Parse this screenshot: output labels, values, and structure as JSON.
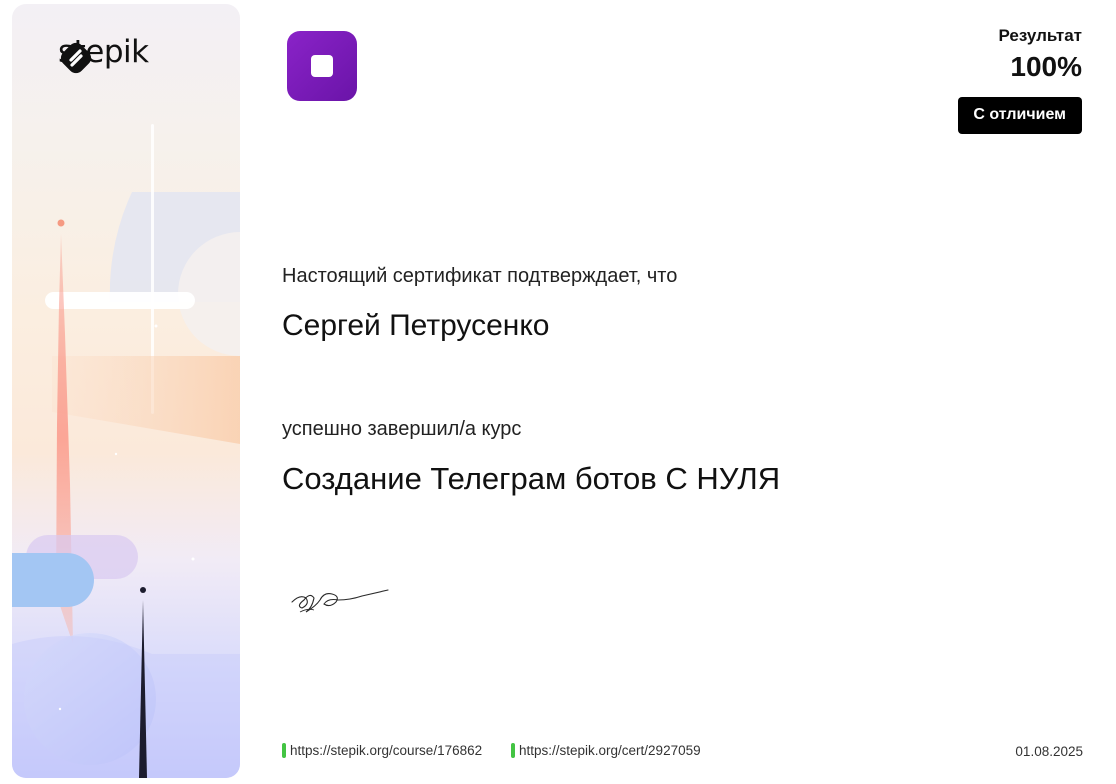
{
  "brand": {
    "name": "stepik"
  },
  "course_logo": {
    "color": "#7a1cb8"
  },
  "result": {
    "label": "Результат",
    "value": "100%",
    "badge": "С отличием"
  },
  "certificate": {
    "confirm_text": "Настоящий сертификат подтверждает, что",
    "recipient": "Сергей Петрусенко",
    "completed_text": "успешно завершил/а  курс",
    "course_title": "Создание Телеграм ботов С НУЛЯ"
  },
  "footer": {
    "course_url": "https://stepik.org/course/176862",
    "cert_url": "https://stepik.org/cert/2927059",
    "date": "01.08.2025"
  },
  "colors": {
    "link_marker": "#43c443",
    "badge_bg": "#000000"
  }
}
